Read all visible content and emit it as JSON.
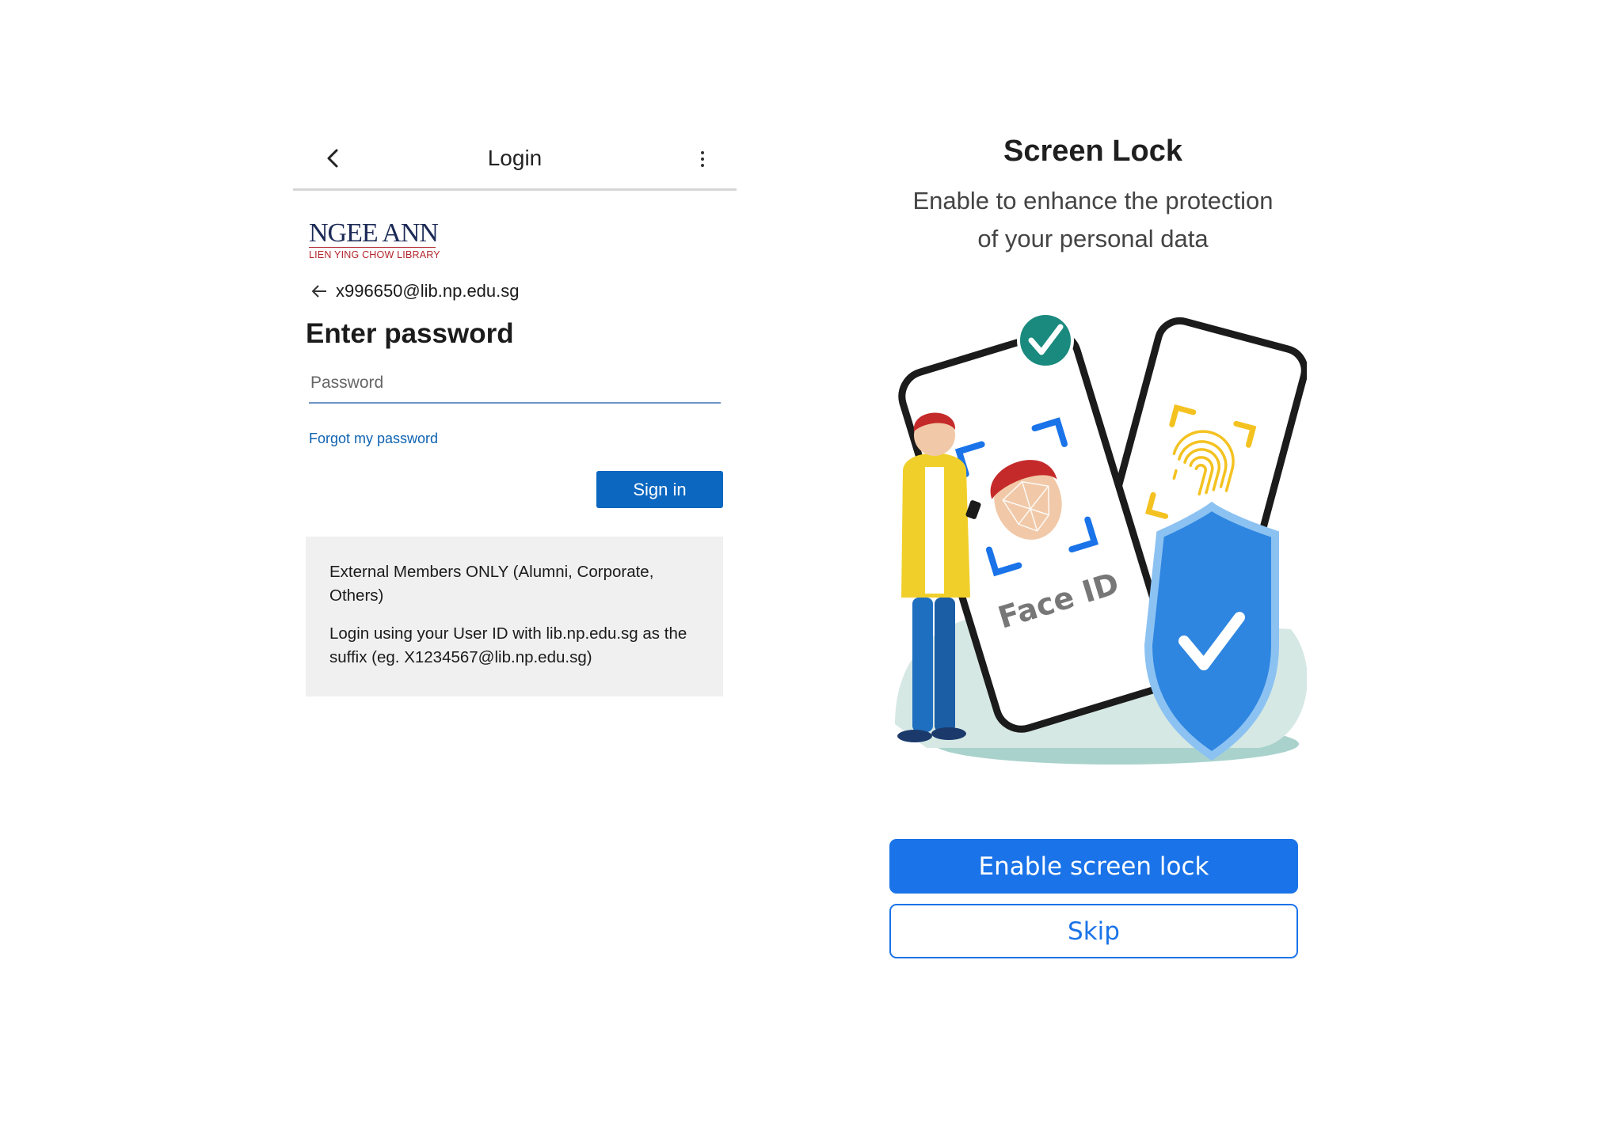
{
  "login": {
    "title": "Login",
    "logo": {
      "brand": "NGEE ANN",
      "subtitle": "LIEN YING CHOW LIBRARY"
    },
    "email": "x996650@lib.np.edu.sg",
    "heading": "Enter password",
    "password_placeholder": "Password",
    "forgot_link": "Forgot my password",
    "signin_label": "Sign in",
    "info": [
      "External Members ONLY (Alumni, Corporate, Others)",
      "Login using your User ID with lib.np.edu.sg as the suffix (eg. X1234567@lib.np.edu.sg)"
    ]
  },
  "screen_lock": {
    "title": "Screen Lock",
    "subtitle_line1": "Enable to enhance the protection",
    "subtitle_line2": "of your personal data",
    "illustration_label": "Face ID",
    "enable_button": "Enable screen lock",
    "skip_button": "Skip"
  },
  "colors": {
    "primary": "#1a73e8",
    "signin": "#0b67c0",
    "link": "#0f62b1",
    "logo_navy": "#1c2a56",
    "logo_red": "#b2262c",
    "check_teal": "#1a8a7e",
    "shield_blue": "#2f86e0"
  },
  "icons": [
    "back-chevron-icon",
    "more-vertical-icon",
    "back-arrow-icon",
    "checkmark-badge-icon",
    "fingerprint-icon",
    "shield-check-icon"
  ]
}
